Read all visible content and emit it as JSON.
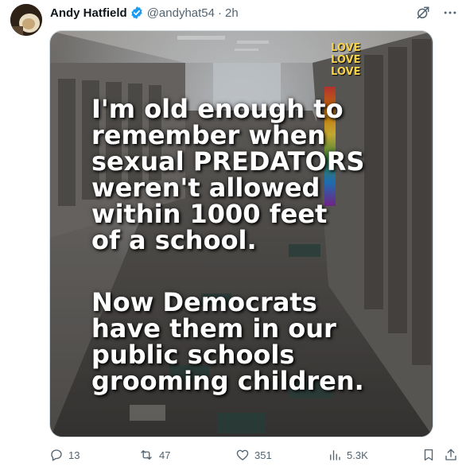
{
  "tweet": {
    "author_name": "Andy Hatfield",
    "handle": "@andyhat54",
    "separator": "·",
    "time": "2h"
  },
  "image": {
    "love_sign": "LOVE\nLOVE\nLOVE",
    "text_block_1": "I'm old enough to\nremember when\nsexual PREDATORS\nweren't allowed\nwithin 1000 feet\nof a school.",
    "text_block_2": "Now Democrats\nhave them in our\npublic schools\ngrooming children."
  },
  "actions": {
    "replies": "13",
    "reposts": "47",
    "likes": "351",
    "views": "5.3K"
  },
  "icons": {
    "verified": "verified-badge-icon",
    "grok": "grok-icon",
    "more": "more-icon",
    "reply": "reply-icon",
    "repost": "repost-icon",
    "like": "like-icon",
    "views": "views-icon",
    "bookmark": "bookmark-icon",
    "share": "share-icon"
  },
  "colors": {
    "accent": "#1d9bf0",
    "muted": "#536471",
    "text": "#0f1419"
  }
}
